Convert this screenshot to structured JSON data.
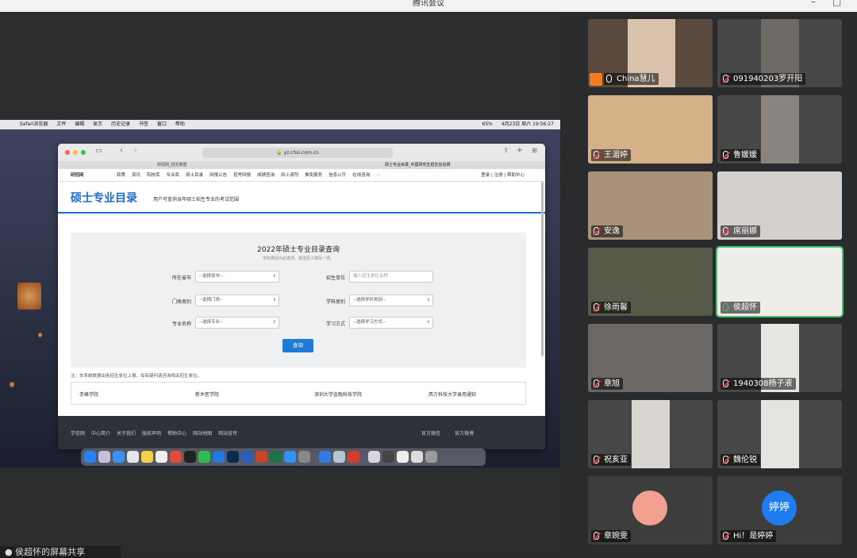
{
  "app": {
    "title": "腾讯会议"
  },
  "share": {
    "sharer_label": "侯超怀的屏幕共享",
    "mac_menubar": {
      "items": [
        "Safari浏览器",
        "文件",
        "编辑",
        "显示",
        "历史记录",
        "书签",
        "窗口",
        "帮助"
      ],
      "battery": "65%",
      "clock": "4月23日 周六 19:56:27"
    },
    "browser": {
      "url": "yz.chsi.com.cn",
      "tab1": "研招网_招生数据",
      "tab2": "硕士专业目录_中国研究生招生信息网",
      "site": {
        "logo": "研招网",
        "nav": [
          "政策",
          "资讯",
          "院校库",
          "专业库",
          "硕士目录",
          "网报公告",
          "招考网报",
          "成绩查询",
          "网上调剂",
          "推免服务",
          "信息公开",
          "在线咨询",
          "···"
        ],
        "tools": "登录 | 注册 | 帮助中心",
        "page_title": "硕士专业目录",
        "page_subtitle": "用户可查询当年硕士招生专业的考试范围"
      },
      "form": {
        "title": "2022年硕士专业目录查询",
        "subtitle": "学科类别为必选项，其他至少填写一项。",
        "province_label": "所在省市",
        "province_value": "--选择省市--",
        "unit_label": "招生单位",
        "unit_placeholder": "输入招生单位名称",
        "category_label": "门类类别",
        "category_value": "--选择门类--",
        "discipline_label": "学科类别",
        "discipline_value": "--选择学科类别--",
        "major_label": "专业名称",
        "major_value": "--选择专业--",
        "mode_label": "学习方式",
        "mode_value": "--选择学习方式--",
        "query_button": "查询"
      },
      "notice": "注：本系统数据由各招生单位上报，如有疑问请咨询相关招生单位。",
      "links": [
        "赤峰学院",
        "新乡医学院",
        "深圳大学金融科技学院",
        "西方科技大学录用通知"
      ],
      "footer": {
        "left": [
          "学信网",
          "中心简介",
          "关于我们",
          "版权声明",
          "帮助中心",
          "网站地图",
          "网站宣传"
        ],
        "right": [
          "官方微信",
          "官方微博"
        ]
      }
    }
  },
  "participants": [
    {
      "name": "China慧儿",
      "mic": "on-white",
      "host": true
    },
    {
      "name": "091940203罗开阳",
      "mic": "muted"
    },
    {
      "name": "王湄婷",
      "mic": "muted"
    },
    {
      "name": "鲁媛媛",
      "mic": "muted"
    },
    {
      "name": "安逸",
      "mic": "muted"
    },
    {
      "name": "席丽娜",
      "mic": "muted"
    },
    {
      "name": "徐雨馨",
      "mic": "muted"
    },
    {
      "name": "侯超怀",
      "mic": "speaking",
      "active": true
    },
    {
      "name": "章旭",
      "mic": "muted"
    },
    {
      "name": "1940308杨子液",
      "mic": "muted"
    },
    {
      "name": "祝亥亚",
      "mic": "muted"
    },
    {
      "name": "魏伦锐",
      "mic": "muted"
    },
    {
      "name": "章婉雯",
      "mic": "muted"
    },
    {
      "name": "Hi！是婷婷",
      "mic": "muted",
      "avatar_text": "婷婷"
    }
  ],
  "colors": {
    "accent_blue": "#1d6bcf",
    "speaking_green": "#3fc66a",
    "muted_red": "#e33344",
    "avatar_blue": "#1e7cf0",
    "avatar_pink": "#f2a08f"
  }
}
